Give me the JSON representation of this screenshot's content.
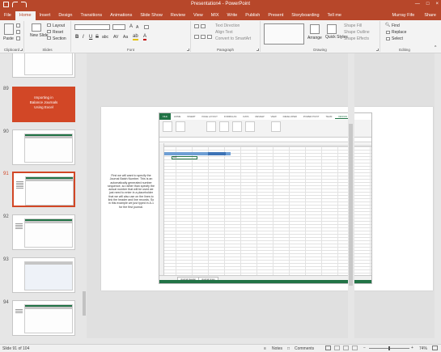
{
  "window": {
    "title": "Presentation4 - PowerPoint",
    "controls": [
      "—",
      "□",
      "×"
    ]
  },
  "tabs": [
    {
      "label": "File"
    },
    {
      "label": "Home"
    },
    {
      "label": "Insert"
    },
    {
      "label": "Design"
    },
    {
      "label": "Transitions"
    },
    {
      "label": "Animations"
    },
    {
      "label": "Slide Show"
    },
    {
      "label": "Review"
    },
    {
      "label": "View"
    },
    {
      "label": "MIX"
    },
    {
      "label": "Write"
    },
    {
      "label": "Publish"
    },
    {
      "label": "Present"
    },
    {
      "label": "Storyboarding"
    },
    {
      "label": "Tell me"
    }
  ],
  "user": "Murray Fife",
  "share": "Share",
  "ribbon": {
    "clipboard": {
      "paste": "Paste",
      "label": "Clipboard"
    },
    "slides": {
      "new_slide": "New Slide",
      "layout": "Layout",
      "reset": "Reset",
      "section": "Section",
      "label": "Slides"
    },
    "font": {
      "label": "Font",
      "bold": "B",
      "italic": "I",
      "underline": "U",
      "strike": "S",
      "shadow": "abc",
      "spacing": "AV",
      "case": "Aa"
    },
    "paragraph": {
      "text_direction": "Text Direction",
      "align_text": "Align Text",
      "smartart": "Convert to SmartArt",
      "label": "Paragraph"
    },
    "drawing": {
      "arrange": "Arrange",
      "quick_styles": "Quick Styles",
      "shape_fill": "Shape Fill",
      "shape_outline": "Shape Outline",
      "shape_effects": "Shape Effects",
      "label": "Drawing"
    },
    "editing": {
      "find": "Find",
      "replace": "Replace",
      "select": "Select",
      "label": "Editing"
    }
  },
  "thumbnails": {
    "numbers": [
      "89",
      "90",
      "91",
      "92",
      "93",
      "94"
    ],
    "orange_text": [
      "Importing in",
      "Balance Journals",
      "Using Excel"
    ]
  },
  "slide": {
    "notes_text": "First we will want to specify the Journal Batch Number. This is an automatically generated number sequence, so rather than specify the actual number that will be used we just need to enter in a placeholder that we will also use on the lines to link the header and line records. So in this example we just typed in A-1 for the first journal."
  },
  "excel": {
    "tabs": [
      "FILE",
      "HOME",
      "INSERT",
      "PAGE LAYOUT",
      "FORMULAS",
      "DATA",
      "REVIEW",
      "VIEW",
      "DEVELOPER",
      "POWER PIVOT",
      "TEAM",
      "DESIGN"
    ],
    "sheet_tabs": [
      "Journal Header",
      "Journal Lines"
    ],
    "cell_a1": "A-1"
  },
  "status": {
    "slide_info": "Slide 91 of 104",
    "notes": "Notes",
    "comments": "Comments",
    "zoom": "74%"
  }
}
